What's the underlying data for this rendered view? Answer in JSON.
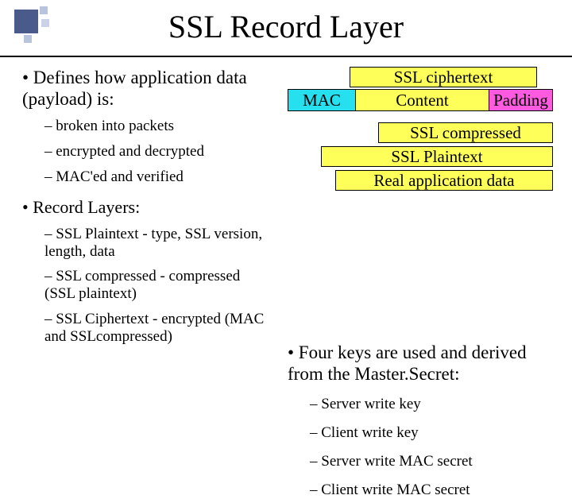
{
  "title": "SSL Record Layer",
  "left": {
    "intro": "• Defines how application data (payload) is:",
    "b1": "– broken into packets",
    "b2": "– encrypted and decrypted",
    "b3": "– MAC'ed and verified",
    "record_layers_hdr": "• Record Layers:",
    "r1": "– SSL Plaintext - type, SSL version, length, data",
    "r2": "– SSL compressed - compressed (SSL plaintext)",
    "r3": "– SSL Ciphertext - encrypted (MAC and SSLcompressed)"
  },
  "diagram": {
    "ciphertext": "SSL ciphertext",
    "mac": "MAC",
    "content": "Content",
    "padding": "Padding",
    "compressed": "SSL compressed",
    "plaintext": "SSL Plaintext",
    "realdata": "Real application data"
  },
  "right": {
    "keys_hdr": "• Four keys are used and derived from the Master.Secret:",
    "k1": "– Server write key",
    "k2": "– Client write key",
    "k3": "– Server write MAC secret",
    "k4": "– Client write MAC secret"
  }
}
